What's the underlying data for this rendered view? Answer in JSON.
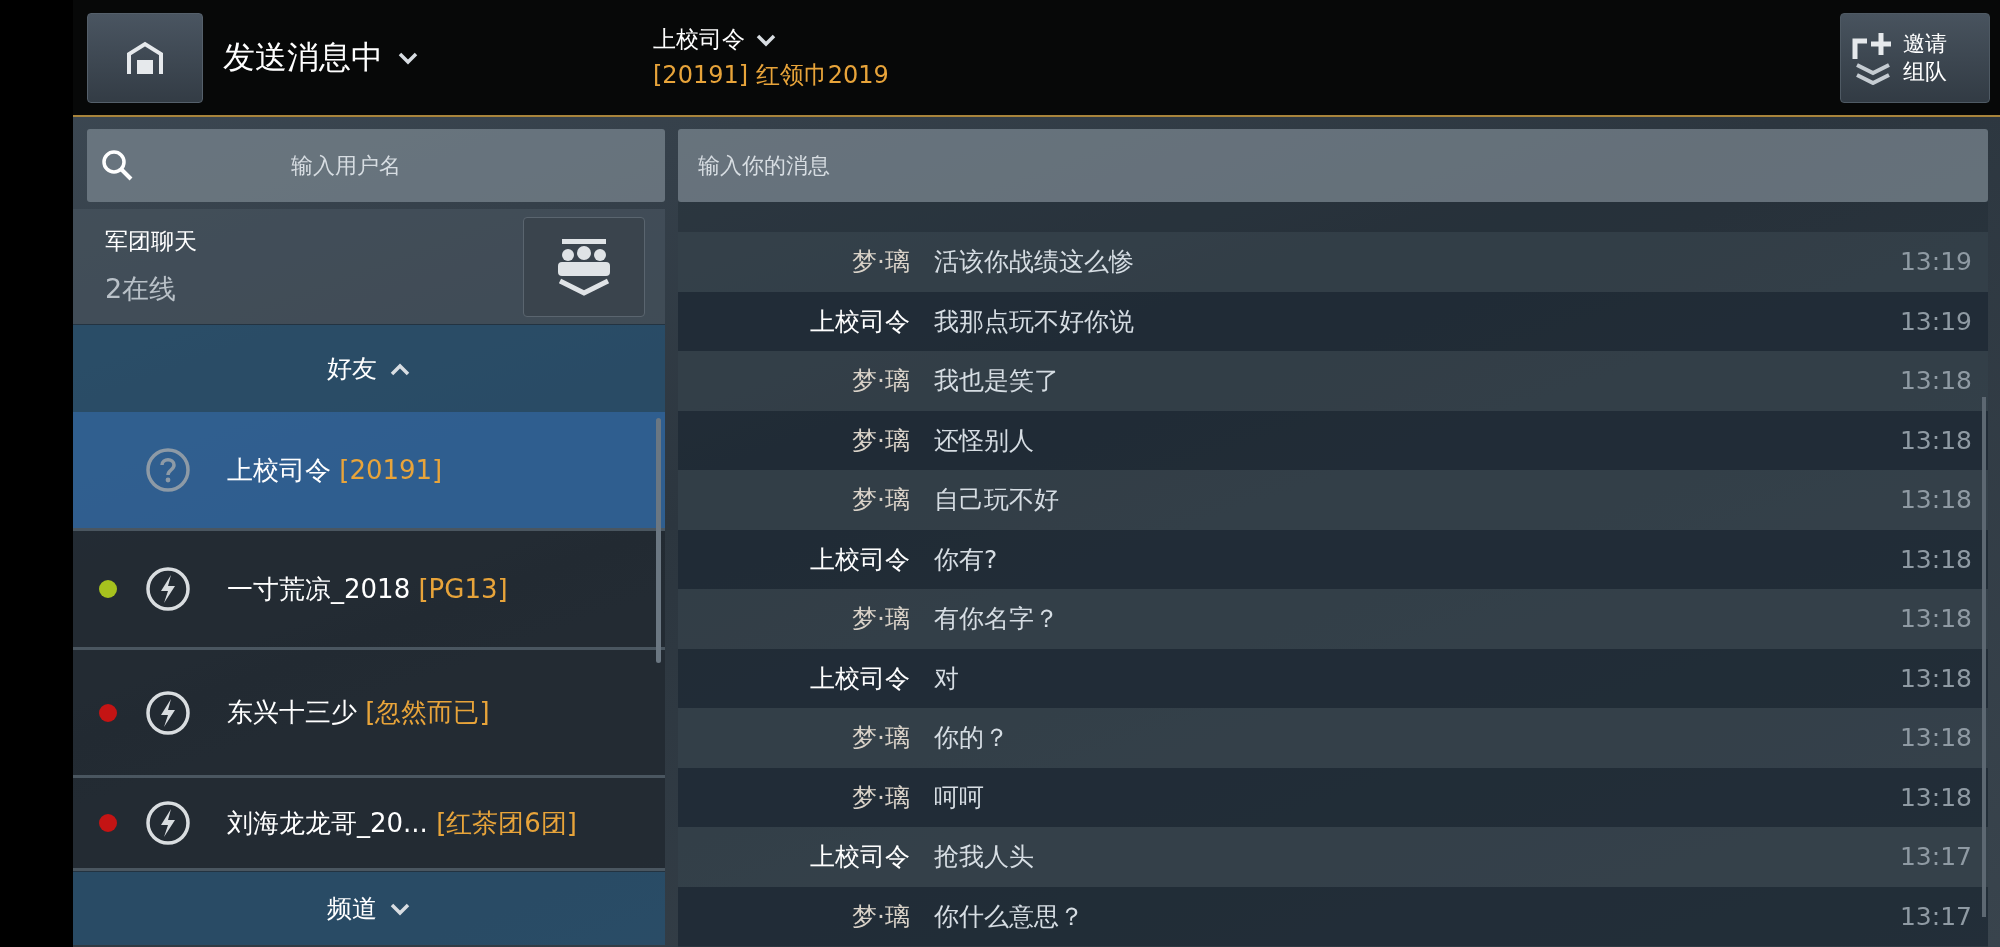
{
  "header": {
    "status": "发送消息中",
    "chat_name": "上校司令",
    "chat_subtitle": "[20191] 红领巾2019",
    "invite_button": [
      "邀请",
      "组队"
    ]
  },
  "search": {
    "placeholder": "输入用户名"
  },
  "message_input": {
    "placeholder": "输入你的消息"
  },
  "legion_chat": {
    "title": "军团聊天",
    "online": "2在线"
  },
  "friends_section": {
    "label": "好友",
    "expanded": true
  },
  "friends": [
    {
      "name": "上校司令",
      "tag": "[20191]",
      "kind": "unknown",
      "selected": true
    },
    {
      "name": "一寸荒凉_2018",
      "tag": "[PG13]",
      "kind": "online",
      "selected": false,
      "color": "#a6c21e"
    },
    {
      "name": "东兴十三少",
      "tag": "[忽然而已]",
      "kind": "online",
      "selected": false,
      "color": "#c41414"
    },
    {
      "name": "刘海龙龙哥_20...",
      "tag": "[红茶团6团]",
      "kind": "online",
      "selected": false,
      "color": "#c41414"
    }
  ],
  "channels_section": {
    "label": "频道",
    "expanded": false
  },
  "messages": [
    {
      "sender": "梦·璃",
      "text": "活该你战绩这么惨",
      "time": "13:19",
      "self": false
    },
    {
      "sender": "上校司令",
      "text": "我那点玩不好你说",
      "time": "13:19",
      "self": true
    },
    {
      "sender": "梦·璃",
      "text": "我也是笑了",
      "time": "13:18",
      "self": false
    },
    {
      "sender": "梦·璃",
      "text": "还怪别人",
      "time": "13:18",
      "self": false
    },
    {
      "sender": "梦·璃",
      "text": "自己玩不好",
      "time": "13:18",
      "self": false
    },
    {
      "sender": "上校司令",
      "text": "你有?",
      "time": "13:18",
      "self": true
    },
    {
      "sender": "梦·璃",
      "text": "有你名字？",
      "time": "13:18",
      "self": false
    },
    {
      "sender": "上校司令",
      "text": "对",
      "time": "13:18",
      "self": true
    },
    {
      "sender": "梦·璃",
      "text": "你的？",
      "time": "13:18",
      "self": false
    },
    {
      "sender": "梦·璃",
      "text": "呵呵",
      "time": "13:18",
      "self": false
    },
    {
      "sender": "上校司令",
      "text": "抢我人头",
      "time": "13:17",
      "self": true
    },
    {
      "sender": "梦·璃",
      "text": "你什么意思？",
      "time": "13:17",
      "self": false
    }
  ]
}
